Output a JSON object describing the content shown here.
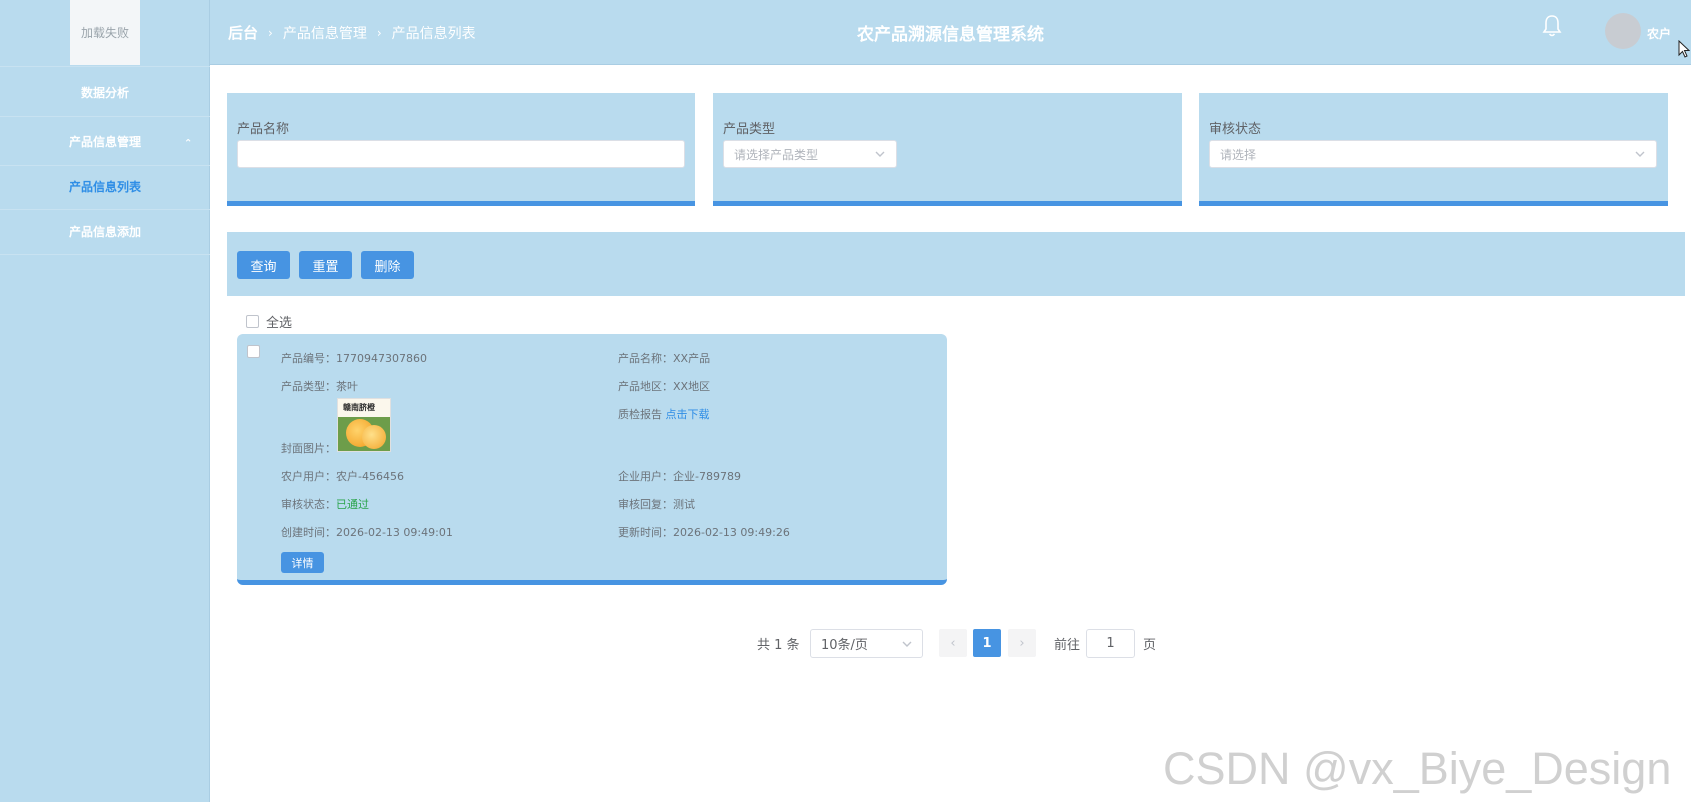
{
  "sidebar": {
    "logo_text": "加载失败",
    "items": [
      {
        "label": "数据分析"
      },
      {
        "label": "产品信息管理"
      },
      {
        "label": "产品信息列表"
      },
      {
        "label": "产品信息添加"
      }
    ]
  },
  "header": {
    "breadcrumb": [
      "后台",
      "产品信息管理",
      "产品信息列表"
    ],
    "breadcrumb_sep": "›",
    "title": "农产品溯源信息管理系统",
    "user_name": "农户"
  },
  "filters": {
    "product_name": {
      "label": "产品名称",
      "value": ""
    },
    "product_type": {
      "label": "产品类型",
      "placeholder": "请选择产品类型"
    },
    "audit_status": {
      "label": "审核状态",
      "placeholder": "请选择"
    }
  },
  "actions": {
    "query": "查询",
    "reset": "重置",
    "delete": "删除"
  },
  "select_all_label": "全选",
  "card": {
    "product_no": {
      "label": "产品编号：",
      "value": "1770947307860"
    },
    "product_name": {
      "label": "产品名称：",
      "value": "XX产品"
    },
    "product_type": {
      "label": "产品类型：",
      "value": "茶叶"
    },
    "product_region": {
      "label": "产品地区：",
      "value": "XX地区"
    },
    "quality_report": {
      "label": "质检报告 ",
      "link": "点击下载"
    },
    "cover_label": "封面图片：",
    "cover_text": "赣南脐橙",
    "farmer_user": {
      "label": "农户用户：",
      "value": "农户-456456"
    },
    "company_user": {
      "label": "企业用户：",
      "value": "企业-789789"
    },
    "audit_status": {
      "label": "审核状态：",
      "value": "已通过"
    },
    "audit_reply": {
      "label": "审核回复：",
      "value": "测试"
    },
    "created_time": {
      "label": "创建时间：",
      "value": "2026-02-13 09:49:01"
    },
    "updated_time": {
      "label": "更新时间：",
      "value": "2026-02-13 09:49:26"
    },
    "detail_button": "详情"
  },
  "pagination": {
    "total": "共 1 条",
    "page_size": "10条/页",
    "prev": "‹",
    "next": "›",
    "current_page": "1",
    "goto_label": "前往",
    "goto_value": "1",
    "page_suffix": "页"
  },
  "watermark": "CSDN @vx_Biye_Design",
  "colors": {
    "panel": "#b9dbee",
    "accent": "#4794e2",
    "link": "#2f8ee6",
    "success": "#2aa44b"
  }
}
